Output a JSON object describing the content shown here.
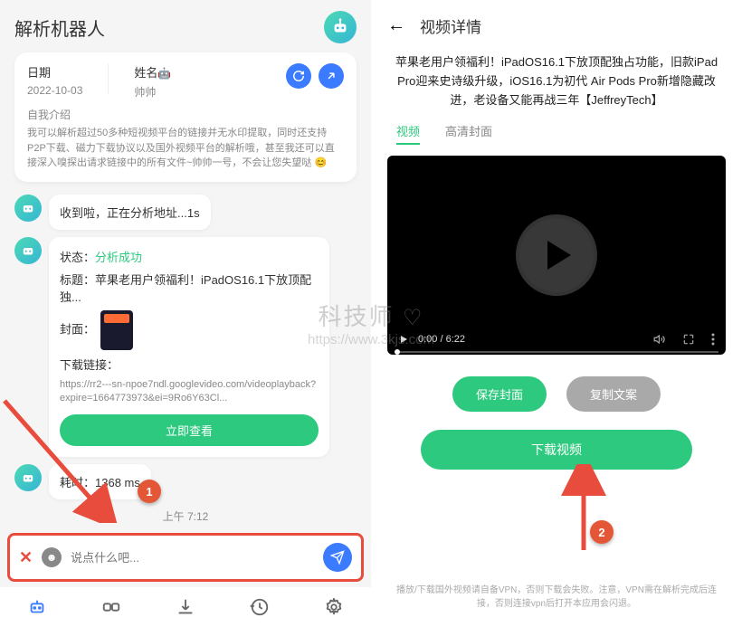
{
  "left": {
    "title": "解析机器人",
    "profile": {
      "date_label": "日期",
      "date_value": "2022-10-03",
      "name_label": "姓名",
      "name_value": "帅帅",
      "bio_label": "自我介绍",
      "bio_text": "我可以解析超过50多种短视频平台的链接并无水印提取，同时还支持P2P下载、磁力下载协议以及国外视频平台的解析哦，甚至我还可以直接深入嗅探出请求链接中的所有文件~帅帅一号，不会让您失望哒 😊"
    },
    "msg1": "收到啦，正在分析地址...1s",
    "result": {
      "status_label": "状态：",
      "status_value": "分析成功",
      "title_label": "标题：",
      "title_value": "苹果老用户领福利！iPadOS16.1下放顶配独...",
      "cover_label": "封面：",
      "link_label": "下载链接：",
      "link_value": "https://rr2---sn-npoe7ndl.googlevideo.com/videoplayback?expire=1664773973&ei=9Ro6Y63Cl...",
      "view_btn": "立即查看"
    },
    "elapsed_label": "耗时：",
    "elapsed_value": "1368 ms",
    "timestamp": "上午 7:12",
    "input_placeholder": "说点什么吧...",
    "marker1": "1"
  },
  "right": {
    "title": "视频详情",
    "desc": "苹果老用户领福利！iPadOS16.1下放顶配独占功能，旧款iPad Pro迎来史诗级升级，iOS16.1为初代 Air Pods Pro新增隐藏改进，老设备又能再战三年【JeffreyTech】",
    "tab_video": "视频",
    "tab_cover": "高清封面",
    "time": "0:00 / 6:22",
    "save_cover": "保存封面",
    "copy_text": "复制文案",
    "download": "下载视频",
    "footnote": "播放/下载国外视频请自备VPN，否则下载会失败。注意，VPN需在解析完成后连接，否则连接vpn后打开本应用会闪退。",
    "marker2": "2"
  },
  "watermark": {
    "line1": "科技师",
    "line2": "https://www.3kjs.com"
  }
}
